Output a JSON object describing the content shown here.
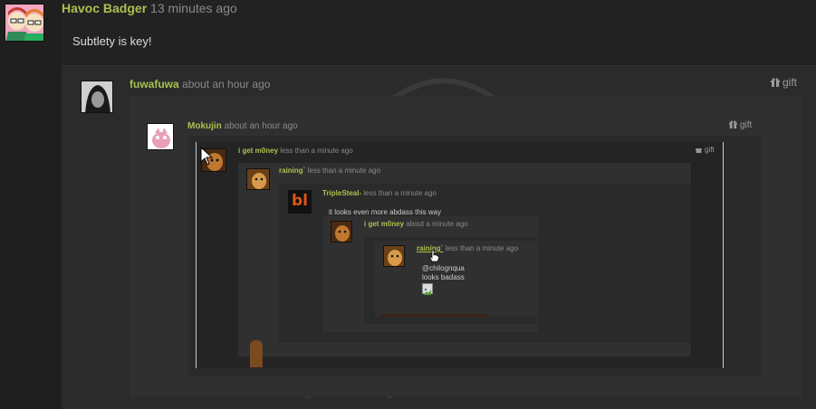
{
  "thread": {
    "comment1": {
      "user": "Havoc Badger",
      "time": "13 minutes ago",
      "body": "Subtlety is key!"
    },
    "comment2": {
      "user": "fuwafuwa",
      "time": "about an hour ago",
      "gift": "gift"
    },
    "comment3": {
      "user": "Mokujin",
      "time": "about an hour ago",
      "gift": "gift"
    },
    "comment4": {
      "user": "i get m0ney",
      "time": "less than a minute ago",
      "gift": "gift"
    },
    "comment5": {
      "user": "raining`",
      "time": "less than a minute ago"
    },
    "comment6": {
      "user": "TripleSteal-",
      "time": "less than a minute ago",
      "body": "it looks even more abdass this way",
      "avatar_text": "bl"
    },
    "comment7": {
      "user": "i get m0ney",
      "time": "about a minute ago"
    },
    "comment8": {
      "user": "raining`",
      "time": "less than a minute ago",
      "body_line1": "@chilognqua",
      "body_line2": "looks badass"
    }
  },
  "colors": {
    "username": "#a9c14f",
    "background": "#222222",
    "timestamp": "#8a8a8a"
  }
}
